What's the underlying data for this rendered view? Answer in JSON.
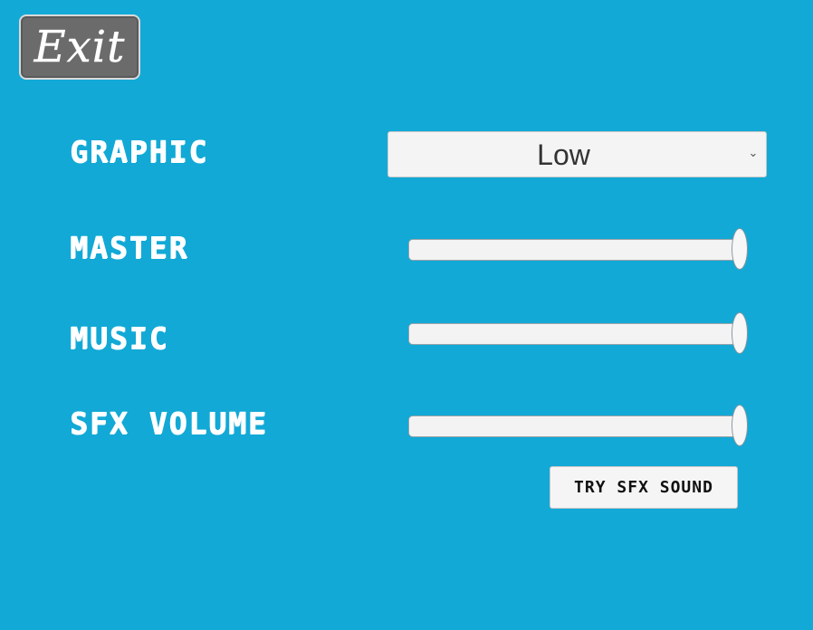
{
  "exit_button": {
    "label": "Exit"
  },
  "settings": {
    "graphic": {
      "label": "GRAPHIC",
      "selected": "Low",
      "arrow_icon": "chevron-down-icon"
    },
    "master": {
      "label": "MASTER",
      "value": 1.0
    },
    "music": {
      "label": "MUSIC",
      "value": 1.0
    },
    "sfx": {
      "label": "SFX VOLUME",
      "value": 1.0
    }
  },
  "try_sfx_button": {
    "label": "TRY SFX SOUND"
  },
  "colors": {
    "background": "#12a9d6",
    "exit_button": "#6b6b6b",
    "control_bg": "#f4f4f4",
    "label_text": "#ffffff"
  }
}
